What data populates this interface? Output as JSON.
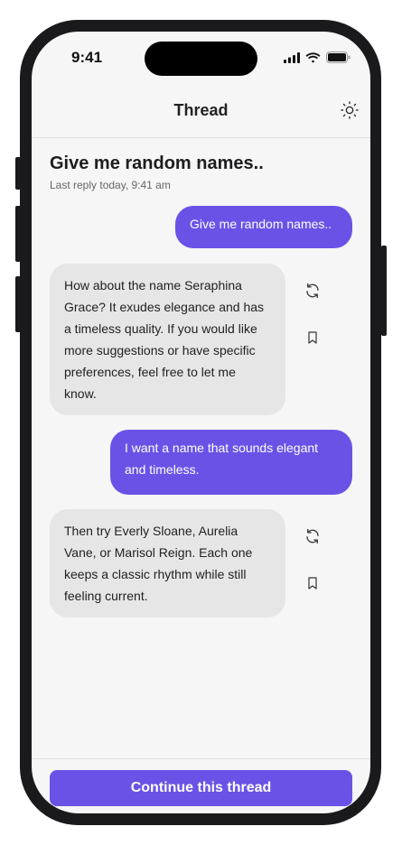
{
  "status_bar": {
    "time": "9:41",
    "icons": [
      "signal-icon",
      "wifi-icon",
      "battery-icon"
    ]
  },
  "header": {
    "title": "Thread",
    "theme_icon": "sun-icon"
  },
  "thread": {
    "title": "Give me random names..",
    "last_reply": "Last reply today, 9:41 am"
  },
  "messages": [
    {
      "role": "user",
      "text": "Give me random names.."
    },
    {
      "role": "assistant",
      "text": "How about the name Seraphina Grace? It exudes elegance and has a timeless quality. If you would like more suggestions or have specific preferences, feel free to let me know.",
      "actions": [
        "refresh-icon",
        "bookmark-icon"
      ]
    },
    {
      "role": "user",
      "text": "I want a name that sounds elegant and timeless."
    },
    {
      "role": "assistant",
      "text": "Then try Everly Sloane, Aurelia Vane, or Marisol Reign. Each one keeps a classic rhythm while still feeling current.",
      "actions": [
        "refresh-icon",
        "bookmark-icon"
      ]
    }
  ],
  "footer": {
    "continue_label": "Continue this thread"
  },
  "colors": {
    "accent": "#6b52e6",
    "bot_bubble": "#e6e6e6",
    "background": "#f6f6f6"
  }
}
